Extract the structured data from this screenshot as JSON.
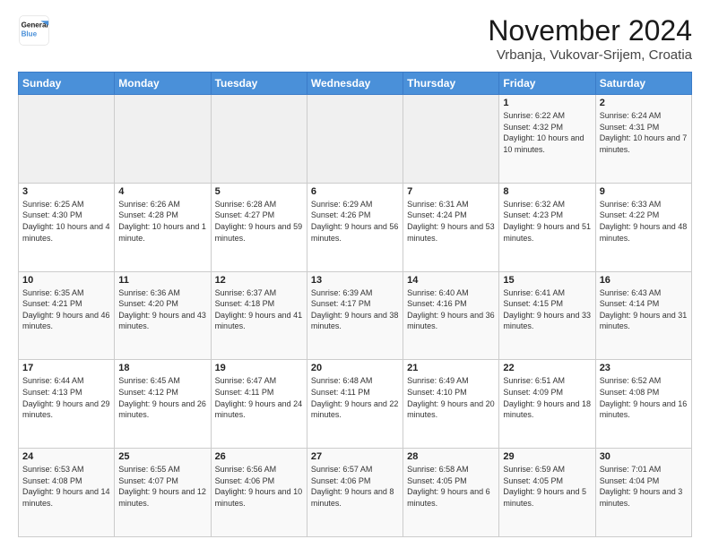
{
  "logo": {
    "line1": "General",
    "line2": "Blue"
  },
  "title": "November 2024",
  "subtitle": "Vrbanja, Vukovar-Srijem, Croatia",
  "weekdays": [
    "Sunday",
    "Monday",
    "Tuesday",
    "Wednesday",
    "Thursday",
    "Friday",
    "Saturday"
  ],
  "weeks": [
    [
      {
        "day": "",
        "info": ""
      },
      {
        "day": "",
        "info": ""
      },
      {
        "day": "",
        "info": ""
      },
      {
        "day": "",
        "info": ""
      },
      {
        "day": "",
        "info": ""
      },
      {
        "day": "1",
        "info": "Sunrise: 6:22 AM\nSunset: 4:32 PM\nDaylight: 10 hours and 10 minutes."
      },
      {
        "day": "2",
        "info": "Sunrise: 6:24 AM\nSunset: 4:31 PM\nDaylight: 10 hours and 7 minutes."
      }
    ],
    [
      {
        "day": "3",
        "info": "Sunrise: 6:25 AM\nSunset: 4:30 PM\nDaylight: 10 hours and 4 minutes."
      },
      {
        "day": "4",
        "info": "Sunrise: 6:26 AM\nSunset: 4:28 PM\nDaylight: 10 hours and 1 minute."
      },
      {
        "day": "5",
        "info": "Sunrise: 6:28 AM\nSunset: 4:27 PM\nDaylight: 9 hours and 59 minutes."
      },
      {
        "day": "6",
        "info": "Sunrise: 6:29 AM\nSunset: 4:26 PM\nDaylight: 9 hours and 56 minutes."
      },
      {
        "day": "7",
        "info": "Sunrise: 6:31 AM\nSunset: 4:24 PM\nDaylight: 9 hours and 53 minutes."
      },
      {
        "day": "8",
        "info": "Sunrise: 6:32 AM\nSunset: 4:23 PM\nDaylight: 9 hours and 51 minutes."
      },
      {
        "day": "9",
        "info": "Sunrise: 6:33 AM\nSunset: 4:22 PM\nDaylight: 9 hours and 48 minutes."
      }
    ],
    [
      {
        "day": "10",
        "info": "Sunrise: 6:35 AM\nSunset: 4:21 PM\nDaylight: 9 hours and 46 minutes."
      },
      {
        "day": "11",
        "info": "Sunrise: 6:36 AM\nSunset: 4:20 PM\nDaylight: 9 hours and 43 minutes."
      },
      {
        "day": "12",
        "info": "Sunrise: 6:37 AM\nSunset: 4:18 PM\nDaylight: 9 hours and 41 minutes."
      },
      {
        "day": "13",
        "info": "Sunrise: 6:39 AM\nSunset: 4:17 PM\nDaylight: 9 hours and 38 minutes."
      },
      {
        "day": "14",
        "info": "Sunrise: 6:40 AM\nSunset: 4:16 PM\nDaylight: 9 hours and 36 minutes."
      },
      {
        "day": "15",
        "info": "Sunrise: 6:41 AM\nSunset: 4:15 PM\nDaylight: 9 hours and 33 minutes."
      },
      {
        "day": "16",
        "info": "Sunrise: 6:43 AM\nSunset: 4:14 PM\nDaylight: 9 hours and 31 minutes."
      }
    ],
    [
      {
        "day": "17",
        "info": "Sunrise: 6:44 AM\nSunset: 4:13 PM\nDaylight: 9 hours and 29 minutes."
      },
      {
        "day": "18",
        "info": "Sunrise: 6:45 AM\nSunset: 4:12 PM\nDaylight: 9 hours and 26 minutes."
      },
      {
        "day": "19",
        "info": "Sunrise: 6:47 AM\nSunset: 4:11 PM\nDaylight: 9 hours and 24 minutes."
      },
      {
        "day": "20",
        "info": "Sunrise: 6:48 AM\nSunset: 4:11 PM\nDaylight: 9 hours and 22 minutes."
      },
      {
        "day": "21",
        "info": "Sunrise: 6:49 AM\nSunset: 4:10 PM\nDaylight: 9 hours and 20 minutes."
      },
      {
        "day": "22",
        "info": "Sunrise: 6:51 AM\nSunset: 4:09 PM\nDaylight: 9 hours and 18 minutes."
      },
      {
        "day": "23",
        "info": "Sunrise: 6:52 AM\nSunset: 4:08 PM\nDaylight: 9 hours and 16 minutes."
      }
    ],
    [
      {
        "day": "24",
        "info": "Sunrise: 6:53 AM\nSunset: 4:08 PM\nDaylight: 9 hours and 14 minutes."
      },
      {
        "day": "25",
        "info": "Sunrise: 6:55 AM\nSunset: 4:07 PM\nDaylight: 9 hours and 12 minutes."
      },
      {
        "day": "26",
        "info": "Sunrise: 6:56 AM\nSunset: 4:06 PM\nDaylight: 9 hours and 10 minutes."
      },
      {
        "day": "27",
        "info": "Sunrise: 6:57 AM\nSunset: 4:06 PM\nDaylight: 9 hours and 8 minutes."
      },
      {
        "day": "28",
        "info": "Sunrise: 6:58 AM\nSunset: 4:05 PM\nDaylight: 9 hours and 6 minutes."
      },
      {
        "day": "29",
        "info": "Sunrise: 6:59 AM\nSunset: 4:05 PM\nDaylight: 9 hours and 5 minutes."
      },
      {
        "day": "30",
        "info": "Sunrise: 7:01 AM\nSunset: 4:04 PM\nDaylight: 9 hours and 3 minutes."
      }
    ]
  ]
}
